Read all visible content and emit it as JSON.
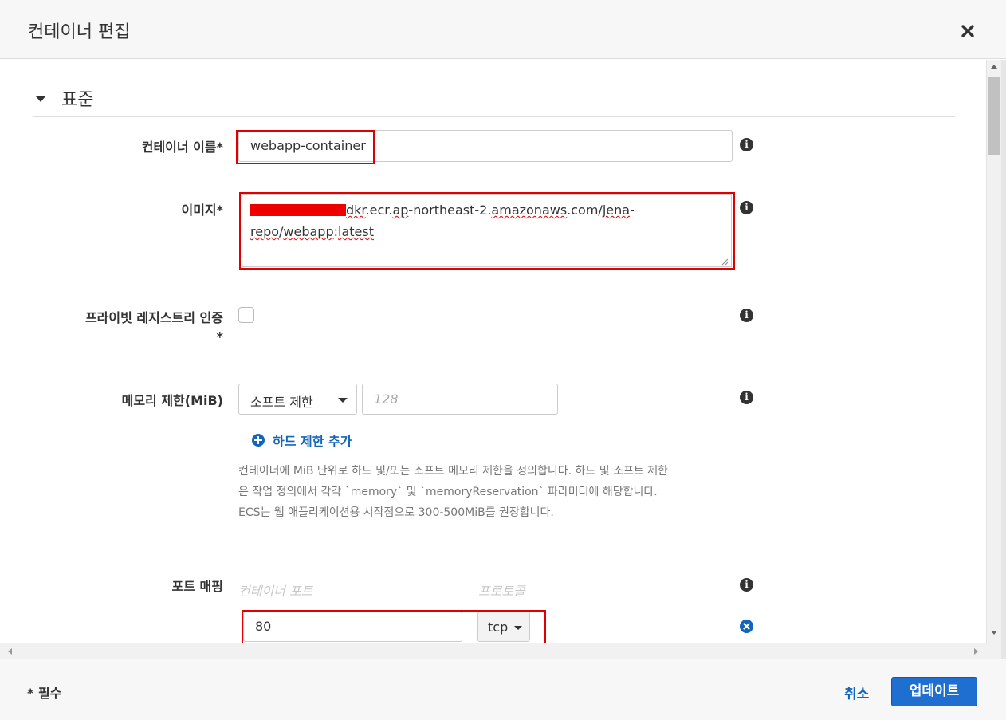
{
  "dialog": {
    "title": "컨테이너 편집",
    "section_title": "표준"
  },
  "fields": {
    "container_name": {
      "label": "컨테이너 이름*",
      "value": "webapp-container"
    },
    "image": {
      "label": "이미지*",
      "line1_segments": [
        "dkr",
        ".ecr.",
        "ap",
        "-northeast-2.",
        "amazonaws",
        ".com/",
        "jena",
        "-"
      ],
      "line2_segments": [
        "repo",
        "/",
        "webapp",
        ":",
        "latest"
      ]
    },
    "private_registry": {
      "label_line1": "프라이빗 레지스트리 인증",
      "label_line2": "*"
    },
    "memory_limit": {
      "label": "메모리 제한(MiB)",
      "select_value": "소프트 제한",
      "input_placeholder": "128",
      "add_link": "하드 제한 추가",
      "help_lines": [
        "컨테이너에 MiB 단위로 하드 및/또는 소프트 메모리 제한을 정의합니다. 하드 및 소프트 제한",
        "은 작업 정의에서 각각 `memory` 및 `memoryReservation` 파라미터에 해당합니다.",
        "ECS는 웹 애플리케이션용 시작점으로 300-500MiB를 권장합니다."
      ]
    },
    "port_mapping": {
      "label": "포트 매핑",
      "col_container_port": "컨테이너 포트",
      "col_protocol": "프로토콜",
      "container_port": "80",
      "protocol": "tcp"
    }
  },
  "footer": {
    "required_note": "* 필수",
    "cancel_label": "취소",
    "update_label": "업데이트"
  },
  "icons": {
    "info": "info-icon",
    "close": "close-icon",
    "add": "plus-circle-icon",
    "remove": "x-circle-icon"
  },
  "colors": {
    "accent": "#1166bb",
    "primary_button": "#1f6fd1",
    "highlight": "#e00000"
  }
}
